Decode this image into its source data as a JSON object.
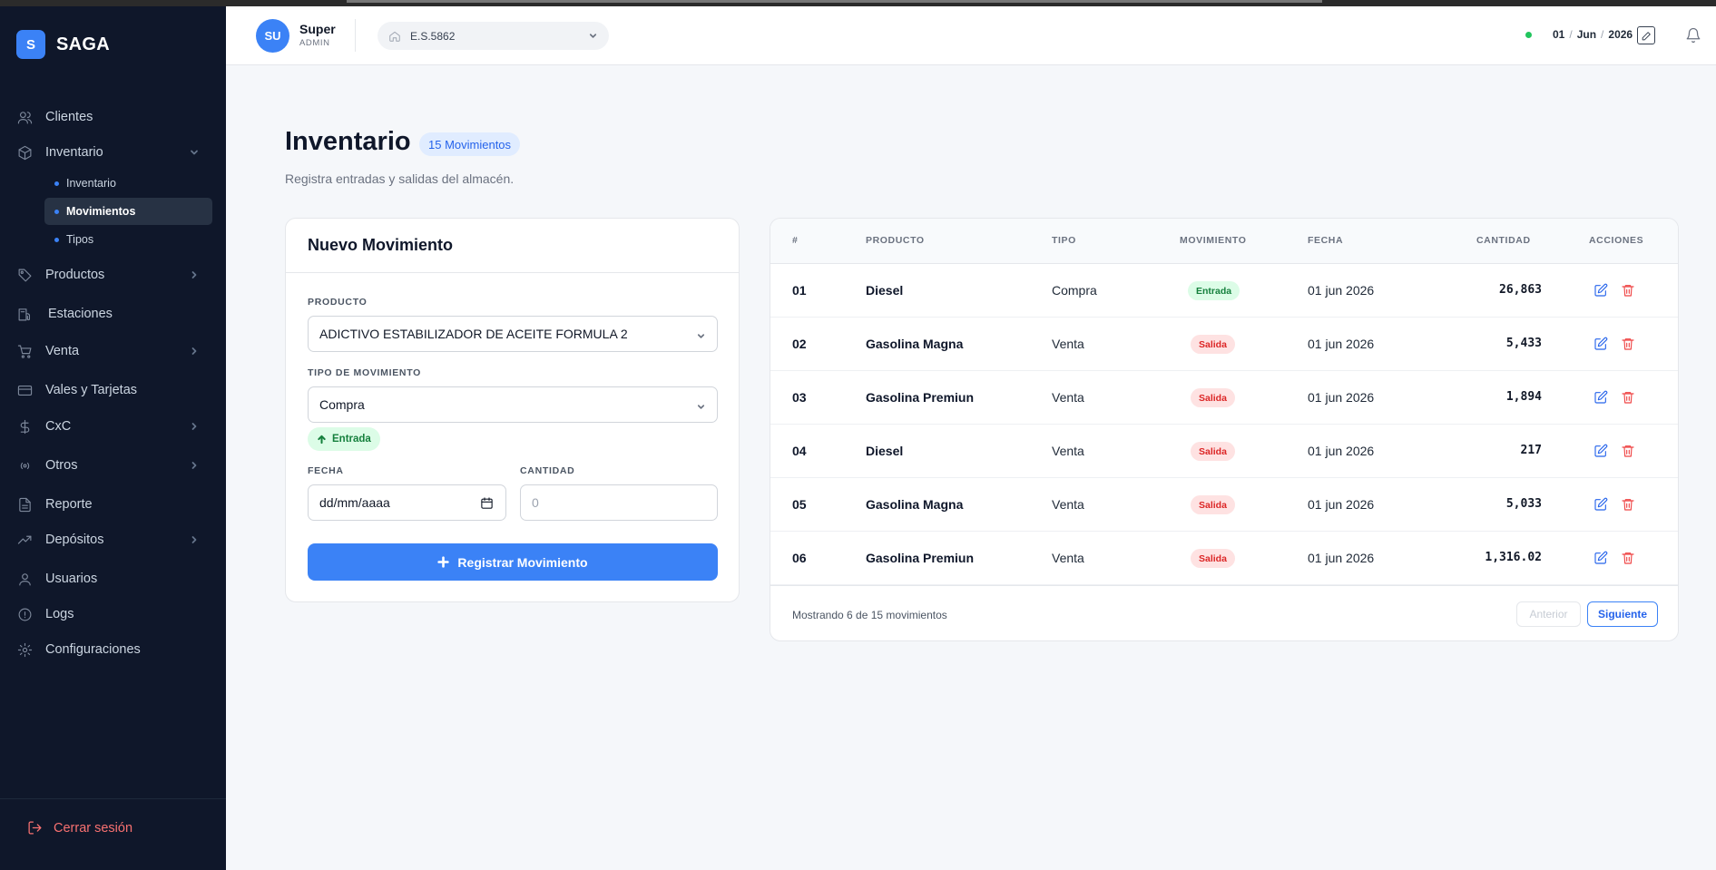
{
  "app": {
    "brand_initial": "S",
    "brand_name": "SAGA"
  },
  "sidebar": {
    "items": [
      {
        "label": "Clientes",
        "icon": "users-icon"
      },
      {
        "label": "Inventario",
        "icon": "box-icon",
        "expanded": true,
        "children": [
          {
            "label": "Inventario",
            "active": false
          },
          {
            "label": "Movimientos",
            "active": true
          },
          {
            "label": "Tipos",
            "active": false
          }
        ]
      },
      {
        "label": "Productos",
        "icon": "tag-icon"
      },
      {
        "label": "Estaciones",
        "icon": "station-icon"
      },
      {
        "label": "Venta",
        "icon": "cart-icon"
      },
      {
        "label": "Vales y Tarjetas",
        "icon": "card-icon"
      },
      {
        "label": "CxC",
        "icon": "dollar-icon"
      },
      {
        "label": "Otros",
        "icon": "radio-icon"
      },
      {
        "label": "Reporte",
        "icon": "file-icon"
      },
      {
        "label": "Depósitos",
        "icon": "trend-icon"
      },
      {
        "label": "Usuarios",
        "icon": "user-icon"
      },
      {
        "label": "Logs",
        "icon": "info-icon"
      },
      {
        "label": "Configuraciones",
        "icon": "gear-icon"
      }
    ],
    "logout_label": "Cerrar sesión"
  },
  "header": {
    "avatar_initials": "SU",
    "user_name": "Super",
    "user_role": "ADMIN",
    "station": "E.S.5862",
    "date_day": "01",
    "date_month": "Jun",
    "date_year": "2026"
  },
  "page": {
    "title": "Inventario",
    "count_badge": "15 Movimientos",
    "subtitle": "Registra entradas y salidas del almacén."
  },
  "form": {
    "title": "Nuevo Movimiento",
    "product_label": "PRODUCTO",
    "product_value": "ADICTIVO ESTABILIZADOR DE ACEITE FORMULA 2",
    "type_label": "TIPO DE MOVIMIENTO",
    "type_value": "Compra",
    "movement_pill": "Entrada",
    "date_label": "FECHA",
    "date_placeholder": "dd/mm/aaaa",
    "qty_label": "CANTIDAD",
    "qty_placeholder": "0",
    "submit_label": "Registrar Movimiento"
  },
  "table": {
    "columns": [
      "#",
      "PRODUCTO",
      "TIPO",
      "MOVIMIENTO",
      "FECHA",
      "CANTIDAD",
      "ACCIONES"
    ],
    "rows": [
      {
        "num": "01",
        "product": "Diesel",
        "type": "Compra",
        "movement": "Entrada",
        "date": "01 jun 2026",
        "qty": "26,863"
      },
      {
        "num": "02",
        "product": "Gasolina Magna",
        "type": "Venta",
        "movement": "Salida",
        "date": "01 jun 2026",
        "qty": "5,433"
      },
      {
        "num": "03",
        "product": "Gasolina Premiun",
        "type": "Venta",
        "movement": "Salida",
        "date": "01 jun 2026",
        "qty": "1,894"
      },
      {
        "num": "04",
        "product": "Diesel",
        "type": "Venta",
        "movement": "Salida",
        "date": "01 jun 2026",
        "qty": "217"
      },
      {
        "num": "05",
        "product": "Gasolina Magna",
        "type": "Venta",
        "movement": "Salida",
        "date": "01 jun 2026",
        "qty": "5,033"
      },
      {
        "num": "06",
        "product": "Gasolina Premiun",
        "type": "Venta",
        "movement": "Salida",
        "date": "01 jun 2026",
        "qty": "1,316.02"
      }
    ],
    "footer_text": "Mostrando 6 de 15 movimientos",
    "prev_label": "Anterior",
    "next_label": "Siguiente"
  },
  "colors": {
    "sidebar_bg": "#0f172a",
    "accent": "#3b82f6",
    "entrada_bg": "#dcfce7",
    "entrada_text": "#15803d",
    "salida_bg": "#fee2e2",
    "salida_text": "#dc2626"
  }
}
